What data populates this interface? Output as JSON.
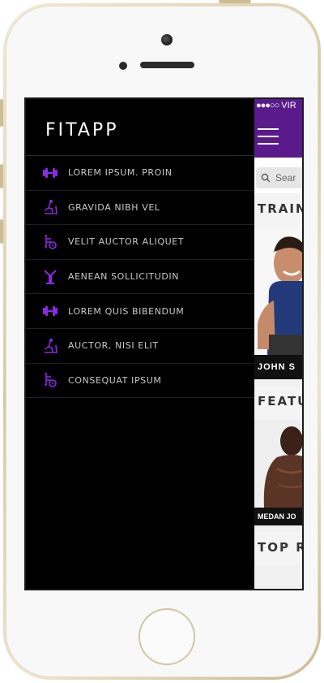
{
  "brand": {
    "title": "FITAPP"
  },
  "status_bar": {
    "signal": "●●●○○",
    "carrier": "VIR"
  },
  "search": {
    "placeholder": "Sear"
  },
  "sections": {
    "trainers": "TRAIN",
    "trainer_caption": "JOHN S",
    "featured": "FEATU",
    "featured_caption": "MEDAN JO",
    "top": "TOP R"
  },
  "menu": {
    "items": [
      {
        "label": "LOREM IPSUM. PROIN",
        "icon": "dumbbell-icon"
      },
      {
        "label": "GRAVIDA NIBH VEL",
        "icon": "treadmill-icon"
      },
      {
        "label": "VELIT AUCTOR ALIQUET",
        "icon": "bike-icon"
      },
      {
        "label": "AENEAN SOLLICITUDIN",
        "icon": "kettlebell-icon"
      },
      {
        "label": "LOREM QUIS BIBENDUM",
        "icon": "dumbbell-icon"
      },
      {
        "label": "AUCTOR, NISI ELIT",
        "icon": "treadmill-icon"
      },
      {
        "label": "CONSEQUAT IPSUM",
        "icon": "bike-icon"
      }
    ]
  },
  "colors": {
    "accent": "#5a1a8c",
    "icon": "#8a2be2",
    "drawer_bg": "#000000",
    "menu_text": "#c9c9c9"
  }
}
